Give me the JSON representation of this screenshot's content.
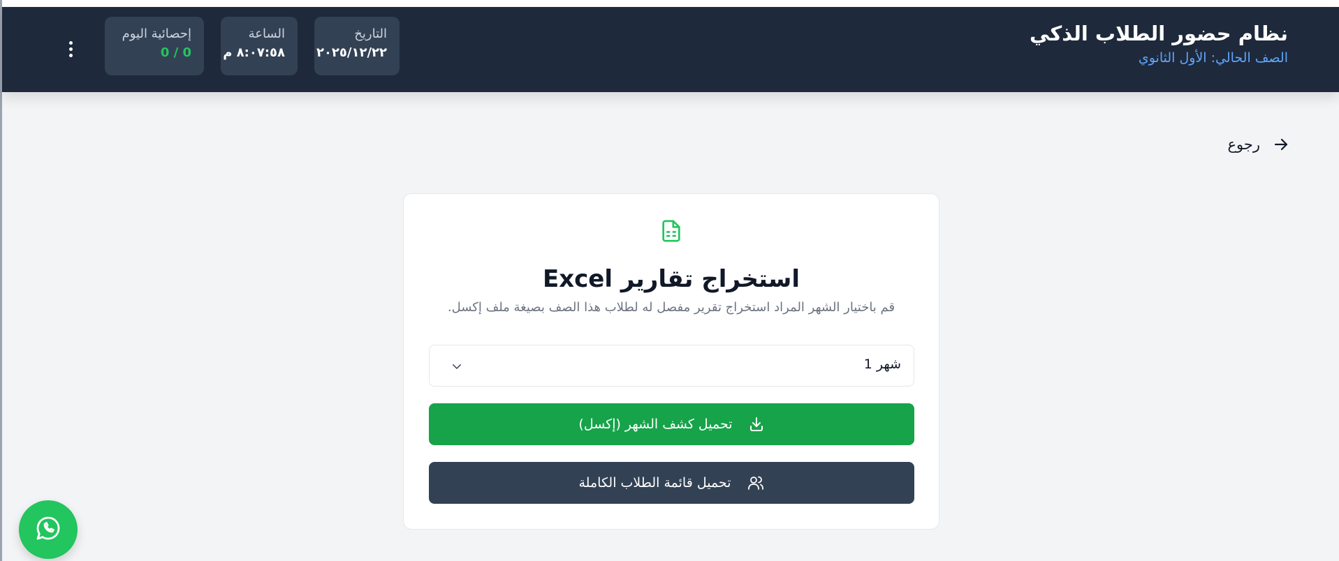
{
  "header": {
    "title": "نظام حضور الطلاب الذكي",
    "current_class": "الصف الحالي: الأول الثانوي",
    "date": {
      "label": "التاريخ",
      "value": "٢٠٢٥/١٢/٢٢"
    },
    "time": {
      "label": "الساعة",
      "value": "٨:٠٧:٥٨ م"
    },
    "today_stats": {
      "label": "إحصائية اليوم",
      "value": "0 / 0"
    },
    "menu_icon": "vertical-dots-icon"
  },
  "back": {
    "label": "رجوع",
    "icon": "arrow-right-icon"
  },
  "export_panel": {
    "icon": "spreadsheet-file-icon",
    "title": "استخراج تقارير Excel",
    "description": "قم باختيار الشهر المراد استخراج تقرير مفصل له لطلاب هذا الصف بصيغة ملف إكسل.",
    "month_select": {
      "value": "شهر 1",
      "icon": "chevron-down-icon"
    },
    "download_month_button": {
      "label": "تحميل كشف الشهر (إكسل)",
      "icon": "download-icon"
    },
    "download_students_button": {
      "label": "تحميل قائمة الطلاب الكاملة",
      "icon": "users-icon"
    }
  },
  "floating_button": {
    "icon": "whatsapp-icon"
  },
  "colors": {
    "header_bg": "#1e293b",
    "card_bg": "#334155",
    "accent_blue": "#60a5fa",
    "success_green": "#16a34a",
    "stat_green": "#22c55e",
    "dark_button": "#334155",
    "page_bg": "#f3f4f6"
  }
}
